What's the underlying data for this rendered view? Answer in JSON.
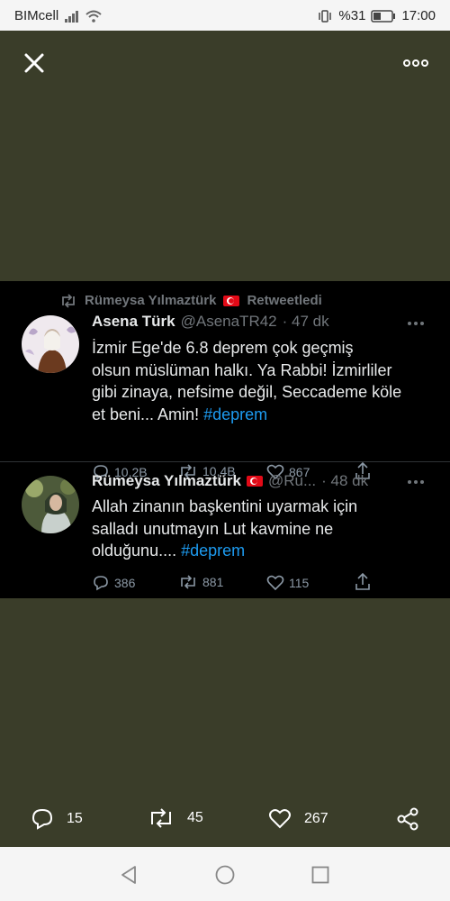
{
  "status_bar": {
    "carrier": "BIMcell",
    "battery": "%31",
    "time": "17:00"
  },
  "retweet_banner": {
    "user": "Rümeysa Yılmaztürk",
    "label": "Retweetledi"
  },
  "tweets": [
    {
      "name": "Asena Türk",
      "handle": "@AsenaTR42",
      "time": "· 47 dk",
      "text_lines": [
        "İzmir Ege'de 6.8  deprem çok geçmiş",
        "olsun müslüman halkı. Ya Rabbi! İzmirliler",
        "gibi zinaya, nefsime değil, Seccademe köle",
        "et beni... Amin!"
      ],
      "hashtag": "#deprem",
      "replies": "10,2B",
      "retweets": "10,4B",
      "likes": "867"
    },
    {
      "name": "Rümeysa Yılmaztürk",
      "handle": "@Ru...",
      "time": "· 48 dk",
      "text_lines": [
        "Allah zinanın başkentini uyarmak için",
        "salladı unutmayın Lut kavmine ne",
        "olduğunu...."
      ],
      "hashtag": "#deprem",
      "replies": "386",
      "retweets": "881",
      "likes": "115"
    }
  ],
  "bottom_bar": {
    "replies": "15",
    "retweets": "45",
    "likes": "267"
  },
  "colors": {
    "background": "#3a3d29",
    "tweet_bg": "#000000",
    "hashtag": "#1d9bf0",
    "muted": "#71767b"
  },
  "icons": [
    "close-icon",
    "more-icon",
    "retweet-icon",
    "reply-icon",
    "like-icon",
    "share-icon",
    "back-icon",
    "home-icon",
    "recents-icon"
  ]
}
